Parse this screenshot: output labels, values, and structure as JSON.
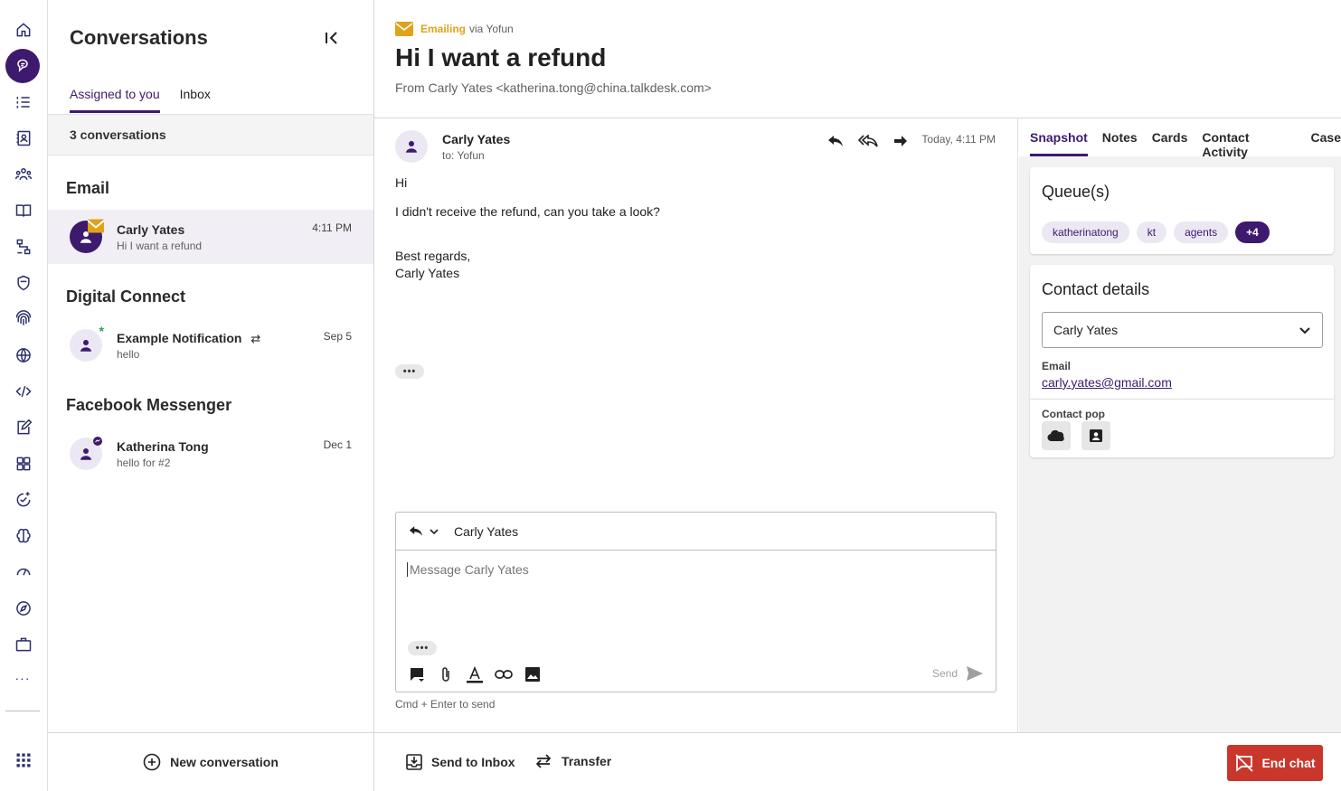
{
  "conversations_panel": {
    "title": "Conversations",
    "tabs": [
      {
        "label": "Assigned to you",
        "active": true
      },
      {
        "label": "Inbox",
        "active": false
      }
    ],
    "count_label": "3 conversations",
    "sections": [
      {
        "title": "Email",
        "items": [
          {
            "name": "Carly Yates",
            "preview": "Hi I want a refund",
            "time": "4:11 PM",
            "selected": true,
            "channel_icon": "email-icon"
          }
        ]
      },
      {
        "title": "Digital Connect",
        "items": [
          {
            "name": "Example Notification",
            "preview": "hello",
            "time": "Sep 5",
            "selected": false,
            "channel_icon": "asterisk-icon"
          }
        ]
      },
      {
        "title": "Facebook Messenger",
        "items": [
          {
            "name": "Katherina Tong",
            "preview": "hello for #2",
            "time": "Dec 1",
            "selected": false,
            "channel_icon": "messenger-icon"
          }
        ]
      }
    ],
    "new_conversation_label": "New conversation"
  },
  "header": {
    "channel_label": "Emailing",
    "via_label": "via Yofun",
    "subject": "Hi I want a refund",
    "from_line": "From Carly Yates <katherina.tong@china.talkdesk.com>"
  },
  "message": {
    "sender": "Carly Yates",
    "to": "to: Yofun",
    "time": "Today, 4:11 PM",
    "body": [
      "Hi",
      "I didn't receive the refund, can you take a look?",
      "Best regards,",
      "Carly Yates"
    ]
  },
  "composer": {
    "recipient": "Carly Yates",
    "placeholder": "Message Carly Yates",
    "send_label": "Send",
    "hint": "Cmd + Enter to send"
  },
  "side_panel": {
    "tabs": [
      {
        "label": "Snapshot",
        "active": true
      },
      {
        "label": "Notes",
        "active": false
      },
      {
        "label": "Cards",
        "active": false
      },
      {
        "label": "Contact Activity",
        "active": false
      },
      {
        "label": "Case",
        "active": false
      }
    ],
    "queues": {
      "title": "Queue(s)",
      "chips": [
        "katherinatong",
        "kt",
        "agents"
      ],
      "more_chip": "+4"
    },
    "contact": {
      "title": "Contact details",
      "selected_contact": "Carly Yates",
      "email_label": "Email",
      "email_value": "carly.yates@gmail.com",
      "contact_pop_label": "Contact pop"
    }
  },
  "bottom_bar": {
    "send_to_inbox": "Send to Inbox",
    "transfer": "Transfer",
    "end_chat": "End chat"
  },
  "colors": {
    "accent": "#3d1a6e",
    "email_orange": "#e0a21a",
    "danger": "#c9372c",
    "chip_bg": "#ece8f3"
  }
}
